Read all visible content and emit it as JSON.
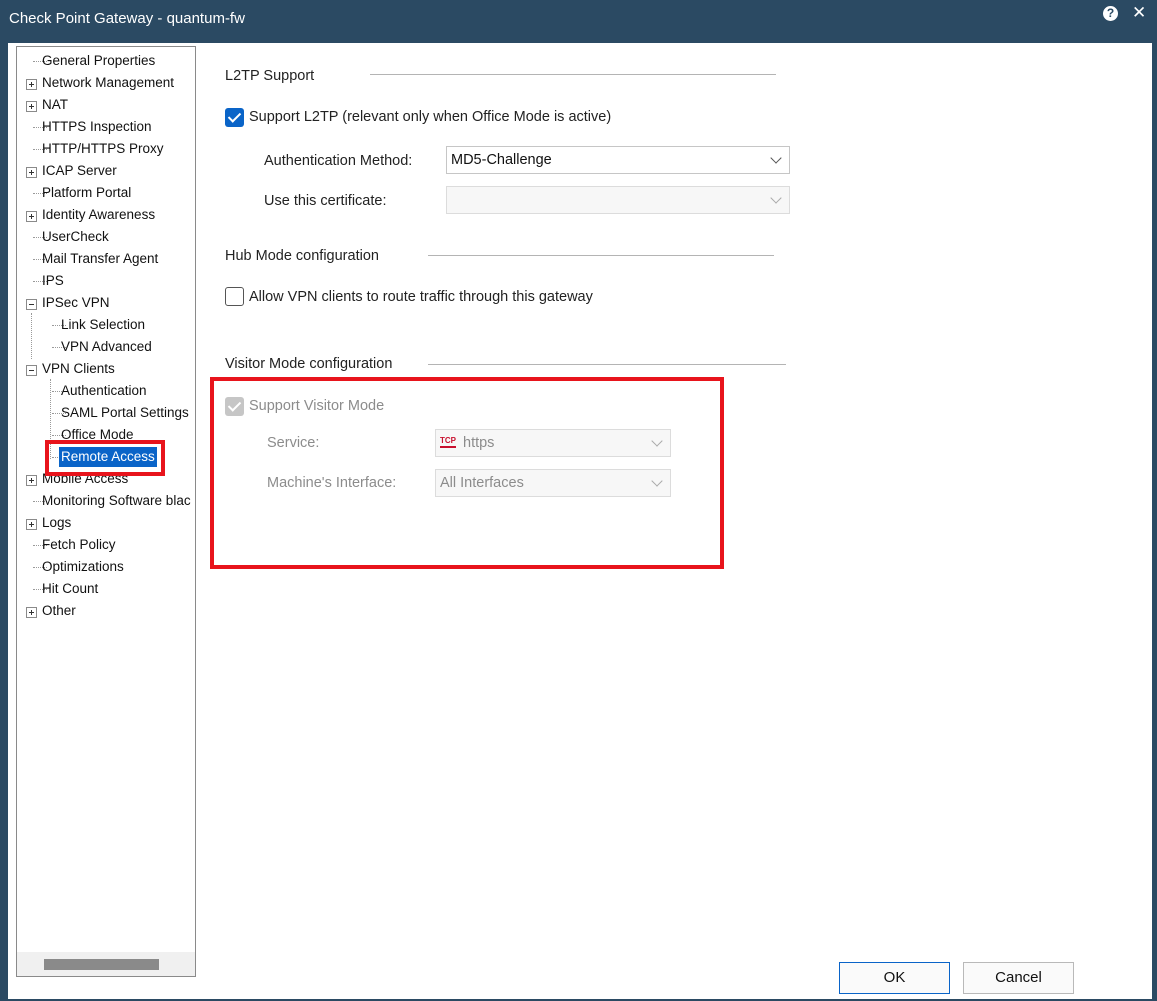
{
  "window": {
    "title": "Check Point Gateway - quantum-fw",
    "help_icon": "question-mark-icon",
    "close_icon": "close-x-icon"
  },
  "tree": {
    "items": [
      {
        "label": "General Properties"
      },
      {
        "label": "Network Management"
      },
      {
        "label": "NAT"
      },
      {
        "label": "HTTPS Inspection"
      },
      {
        "label": "HTTP/HTTPS Proxy"
      },
      {
        "label": "ICAP Server"
      },
      {
        "label": "Platform Portal"
      },
      {
        "label": "Identity Awareness"
      },
      {
        "label": "UserCheck"
      },
      {
        "label": "Mail Transfer Agent"
      },
      {
        "label": "IPS"
      },
      {
        "label": "IPSec VPN"
      },
      {
        "label": "Link Selection"
      },
      {
        "label": "VPN Advanced"
      },
      {
        "label": "VPN Clients"
      },
      {
        "label": "Authentication"
      },
      {
        "label": "SAML Portal Settings"
      },
      {
        "label": "Office Mode"
      },
      {
        "label": "Remote Access"
      },
      {
        "label": "Mobile Access"
      },
      {
        "label": "Monitoring Software blac"
      },
      {
        "label": "Logs"
      },
      {
        "label": "Fetch Policy"
      },
      {
        "label": "Optimizations"
      },
      {
        "label": "Hit Count"
      },
      {
        "label": "Other"
      }
    ],
    "selected": "Remote Access"
  },
  "l2tp": {
    "heading": "L2TP Support",
    "support_label": "Support L2TP (relevant only when Office Mode is active)",
    "support_checked": true,
    "auth_label": "Authentication Method:",
    "auth_value": "MD5-Challenge",
    "cert_label": "Use this certificate:",
    "cert_value": ""
  },
  "hub": {
    "heading": "Hub Mode configuration",
    "allow_label": "Allow VPN clients to route traffic through this gateway",
    "allow_checked": false
  },
  "visitor": {
    "heading": "Visitor Mode configuration",
    "support_label": "Support Visitor Mode",
    "support_checked": true,
    "support_disabled": true,
    "service_label": "Service:",
    "service_protocol": "TCP",
    "service_value": "https",
    "interface_label": "Machine's Interface:",
    "interface_value": "All Interfaces"
  },
  "buttons": {
    "ok": "OK",
    "cancel": "Cancel"
  },
  "colors": {
    "titlebar": "#2b4a63",
    "accent": "#0a64c8",
    "highlight": "#e8141c"
  }
}
